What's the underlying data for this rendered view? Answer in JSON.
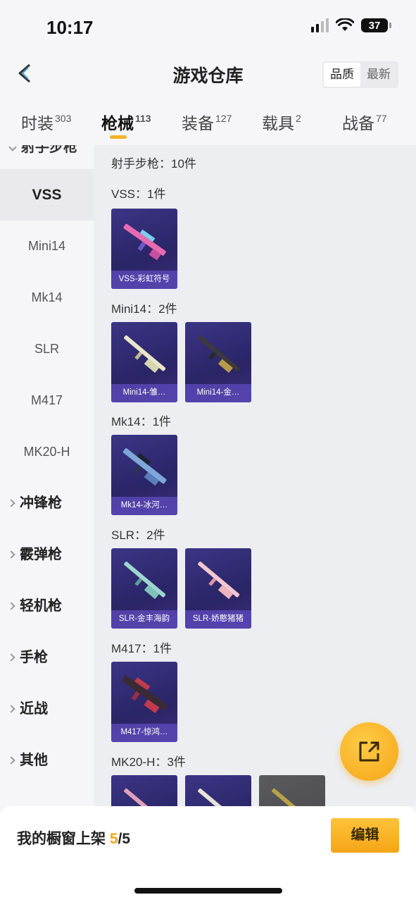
{
  "status_bar": {
    "time": "10:17",
    "battery": "37"
  },
  "nav": {
    "title": "游戏仓库",
    "sort_options": [
      "品质",
      "最新"
    ],
    "active_sort": "品质"
  },
  "tabs": [
    {
      "label": "时装",
      "count": "303"
    },
    {
      "label": "枪械",
      "count": "113"
    },
    {
      "label": "装备",
      "count": "127"
    },
    {
      "label": "载具",
      "count": "2"
    },
    {
      "label": "战备",
      "count": "77"
    }
  ],
  "sidebar": {
    "partial_label": "射手步枪",
    "items": [
      "VSS",
      "Mini14",
      "Mk14",
      "SLR",
      "M417",
      "MK20-H"
    ],
    "categories": [
      "冲锋枪",
      "霰弹枪",
      "轻机枪",
      "手枪",
      "近战",
      "其他"
    ]
  },
  "content": {
    "header": "射手步枪：10件",
    "sections": [
      {
        "title": "VSS：1件",
        "items": [
          "VSS-彩虹符号"
        ]
      },
      {
        "title": "Mini14：2件",
        "items": [
          "Mini14-雏…",
          "Mini14-金…"
        ]
      },
      {
        "title": "Mk14：1件",
        "items": [
          "Mk14-冰河…"
        ]
      },
      {
        "title": "SLR：2件",
        "items": [
          "SLR-金丰海韵",
          "SLR-娇憨猪猪"
        ]
      },
      {
        "title": "M417：1件",
        "items": [
          "M417-惊鸿…"
        ]
      },
      {
        "title": "MK20-H：3件",
        "items": [
          "",
          "",
          ""
        ]
      }
    ]
  },
  "bottom": {
    "shelf_label": "我的橱窗上架",
    "shelf_count": "5",
    "shelf_total": "/5",
    "edit_label": "编辑"
  }
}
